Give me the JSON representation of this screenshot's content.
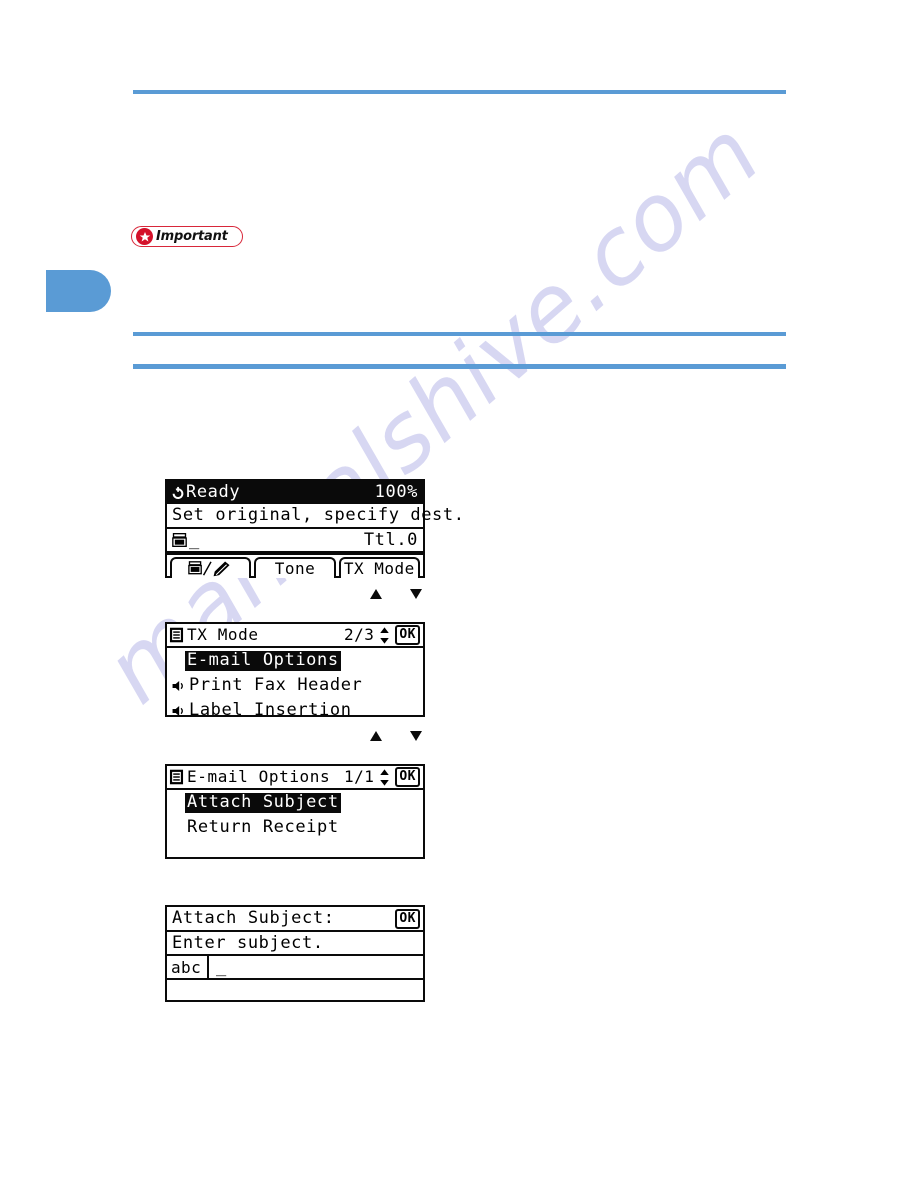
{
  "page": {
    "watermark": "manualshive.com",
    "accent_blue": "#5a9bd5",
    "important_red": "#d4112a"
  },
  "callout": {
    "label": "Important"
  },
  "panels": {
    "status": {
      "icon": "power-standby-icon",
      "title": "Ready",
      "zoom": "100%",
      "message": "Set original, specify dest.",
      "dest_icon": "fax-machine-icon",
      "dest_cursor": "_",
      "total_label": "Ttl.0",
      "softkeys": [
        {
          "name": "fax-pen-softkey",
          "label": "",
          "icon": "fax-and-pen-icon"
        },
        {
          "name": "tone-softkey",
          "label": "Tone",
          "icon": ""
        },
        {
          "name": "tx-mode-softkey",
          "label": "TX Mode",
          "icon": ""
        }
      ]
    },
    "tx_mode": {
      "head_icon": "list-document-icon",
      "title": "TX Mode",
      "page": "2/3",
      "scroll_icon": "up-down-arrows-icon",
      "ok_label": "OK",
      "items": [
        {
          "label": "E-mail Options",
          "selected": true,
          "icon": ""
        },
        {
          "label": "Print Fax Header",
          "selected": false,
          "icon": "speaker-icon"
        },
        {
          "label": "Label Insertion",
          "selected": false,
          "icon": "speaker-icon"
        }
      ]
    },
    "email_options": {
      "head_icon": "list-document-icon",
      "title": "E-mail Options",
      "page": "1/1",
      "scroll_icon": "up-down-arrows-icon",
      "ok_label": "OK",
      "items": [
        {
          "label": "Attach Subject",
          "selected": true,
          "icon": ""
        },
        {
          "label": "Return Receipt",
          "selected": false,
          "icon": ""
        }
      ]
    },
    "attach_subject": {
      "title": "Attach Subject:",
      "ok_label": "OK",
      "message": "Enter subject.",
      "ime_mode": "abc",
      "input_value": "_"
    }
  },
  "separators": {
    "up_arrow": "up-triangle-icon",
    "down_arrow": "down-triangle-icon"
  }
}
